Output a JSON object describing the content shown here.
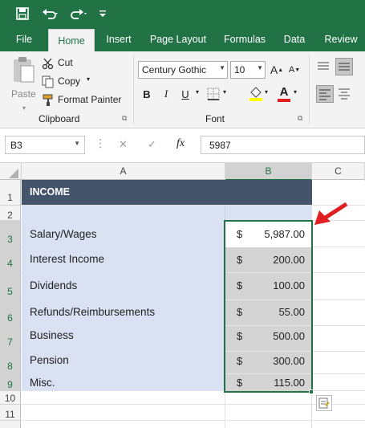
{
  "ribbon_tabs": [
    "File",
    "Home",
    "Insert",
    "Page Layout",
    "Formulas",
    "Data",
    "Review"
  ],
  "active_tab": "Home",
  "clipboard": {
    "paste": "Paste",
    "cut": "Cut",
    "copy": "Copy",
    "format_painter": "Format Painter",
    "group_label": "Clipboard"
  },
  "font": {
    "name": "Century Gothic",
    "size": "10",
    "group_label": "Font",
    "bold": "B",
    "italic": "I",
    "underline": "U",
    "grow": "A",
    "shrink": "A",
    "font_color": "A"
  },
  "formula_bar": {
    "name_box": "B3",
    "fx": "fx",
    "cancel": "✕",
    "enter": "✓",
    "value": "5987"
  },
  "columns": [
    "A",
    "B",
    "C"
  ],
  "rows": [
    "1",
    "2",
    "3",
    "4",
    "5",
    "6",
    "7",
    "8",
    "9",
    "10",
    "11"
  ],
  "sheet": {
    "header": "INCOME",
    "items": [
      {
        "label": "Salary/Wages",
        "currency": "$",
        "amount": "5,987.00"
      },
      {
        "label": "Interest Income",
        "currency": "$",
        "amount": "200.00"
      },
      {
        "label": "Dividends",
        "currency": "$",
        "amount": "100.00"
      },
      {
        "label": "Refunds/Reimbursements",
        "currency": "$",
        "amount": "55.00"
      },
      {
        "label": "Business",
        "currency": "$",
        "amount": "500.00"
      },
      {
        "label": "Pension",
        "currency": "$",
        "amount": "300.00"
      },
      {
        "label": "Misc.",
        "currency": "$",
        "amount": "115.00"
      }
    ]
  },
  "colors": {
    "excel_green": "#217346",
    "header_fill": "#44546a",
    "label_fill": "#d9e1f2",
    "selection_fill": "#d4d4d4",
    "arrow": "#e02020"
  },
  "icons": [
    "save-icon",
    "undo-icon",
    "redo-icon",
    "customize-qat-icon",
    "paste-icon",
    "cut-icon",
    "copy-icon",
    "format-painter-icon",
    "fill-color-icon",
    "font-color-icon",
    "quick-analysis-icon",
    "red-arrow-annotation"
  ]
}
